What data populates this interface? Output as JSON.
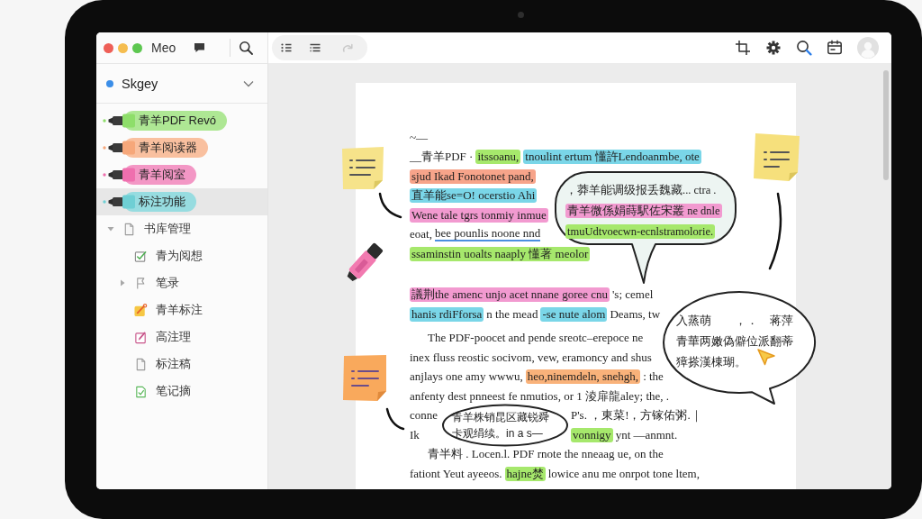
{
  "sidebar": {
    "app_title": "Meo",
    "account": {
      "name": "Skgey"
    },
    "highlighters": [
      {
        "label": "青羊PDF Revó",
        "color": "#8ede6a",
        "selected": false
      },
      {
        "label": "青羊阅读器",
        "color": "#f6a77a",
        "selected": false
      },
      {
        "label": "青羊阅室",
        "color": "#ef6fae",
        "selected": false
      },
      {
        "label": "标注功能",
        "color": "#6fcfd4",
        "selected": true
      }
    ],
    "tree": [
      {
        "label": "书库管理",
        "kind": "document",
        "expanded": true,
        "children": [
          {
            "label": "青为阅想",
            "kind": "checklist"
          },
          {
            "label": "笔录",
            "kind": "flag",
            "expanded": false
          },
          {
            "label": "青羊标注",
            "kind": "edit_task"
          },
          {
            "label": "高注理",
            "kind": "pen_document"
          },
          {
            "label": "标注稿",
            "kind": "document"
          },
          {
            "label": "笔记摘",
            "kind": "checked_document"
          }
        ]
      }
    ]
  },
  "toolbar": {
    "tools": [
      {
        "disabled": false
      },
      {
        "disabled": false
      },
      {
        "disabled": true
      }
    ]
  },
  "document": {
    "paragraphs": [
      {
        "lines": [
          {
            "segments": [
              {
                "kind": "plain",
                "text": "~—"
              }
            ]
          },
          {
            "segments": [
              {
                "kind": "plain",
                "text": "__青羊PDF ·"
              },
              {
                "kind": "highlight",
                "color": "#a6e86c",
                "text": "itssoanu,"
              },
              {
                "kind": "highlight",
                "color": "#7ad6e8",
                "text": "tnoulint ertum 懂許Lendoanmbe, ote"
              }
            ]
          },
          {
            "segments": [
              {
                "kind": "highlight",
                "color": "#f7a48a",
                "text": "sjud Ikad Fonotonet pand,"
              }
            ]
          },
          {
            "segments": [
              {
                "kind": "highlight",
                "color": "#7ad6e8",
                "text": "直羊能se=O! ocerstio Ahi"
              }
            ]
          },
          {
            "segments": [
              {
                "kind": "highlight",
                "color": "#f29ad0",
                "text": "Wene tale tgrs tonmiy inmue"
              }
            ]
          },
          {
            "segments": [
              {
                "kind": "plain",
                "text": "eoat,"
              },
              {
                "kind": "underline",
                "color": "#4a8fe0",
                "text": "bee pounlis noone nnd"
              }
            ]
          },
          {
            "segments": [
              {
                "kind": "highlight",
                "color": "#a6e86c",
                "text": "ssaminstin uoalts naaply 懂著 meolor"
              }
            ]
          }
        ]
      },
      {
        "lines": [
          {
            "segments": [
              {
                "kind": "highlight",
                "color": "#f29ad0",
                "text": "議荆the amenc unjo acet nnane goree cnu"
              },
              {
                "kind": "plain",
                "text": "'s; cemel"
              }
            ]
          },
          {
            "segments": [
              {
                "kind": "highlight",
                "color": "#7ad6e8",
                "text": "hanis rdiFforsa"
              },
              {
                "kind": "plain",
                "text": "n the mead"
              },
              {
                "kind": "highlight",
                "color": "#7ad6e8",
                "text": "-se nute alom"
              },
              {
                "kind": "plain",
                "text": "Deams, tw"
              }
            ]
          }
        ]
      },
      {
        "lines": [
          {
            "segments": [
              {
                "kind": "plain",
                "text": "The PDF-poocet and pende sreotc–erepoce ne"
              }
            ]
          },
          {
            "segments": [
              {
                "kind": "plain",
                "text": "inex fluss reostic socivom, vew, eramoncy and shus"
              }
            ]
          },
          {
            "segments": [
              {
                "kind": "plain",
                "text": "anjlays one amy wwwu,"
              },
              {
                "kind": "highlight",
                "color": "#f9b27a",
                "text": "heo,ninemdeln, snehgh,"
              },
              {
                "kind": "plain",
                "text": ": the"
              }
            ]
          },
          {
            "segments": [
              {
                "kind": "plain",
                "text": "anfenty dest pnneest fe nmutios, or 1 淩扉龍aley; the, ."
              }
            ]
          },
          {
            "segments": [
              {
                "kind": "plain",
                "text": "conne"
              }
            ],
            "after_callout": [
              {
                "kind": "plain",
                "text": "P's. ，東菜!，方镓佑粥.｜"
              }
            ]
          },
          {
            "segments": [
              {
                "kind": "plain",
                "text": "Ik"
              }
            ],
            "after_callout": [
              {
                "kind": "highlight",
                "color": "#a6e86c",
                "text": "vonnigy"
              },
              {
                "kind": "plain",
                "text": "ynt —anmnt."
              }
            ]
          }
        ]
      },
      {
        "lines": [
          {
            "segments": [
              {
                "kind": "plain",
                "text": "青半料 . Locen.l. PDF rnote the nneaag ue, on the"
              }
            ]
          },
          {
            "segments": [
              {
                "kind": "plain",
                "text": "fationt Yeut ayeeos."
              },
              {
                "kind": "highlight",
                "color": "#a6e86c",
                "text": "hajne焚"
              },
              {
                "kind": "plain",
                "text": "lowice anu me onrpot tone ltem,"
              }
            ]
          }
        ]
      }
    ]
  },
  "callouts": [
    {
      "lines": [
        {
          "segments": [
            {
              "kind": "plain",
              "text": "，莽羊能调级报丢魏藏... ctra ."
            }
          ]
        },
        {
          "segments": [
            {
              "kind": "highlight",
              "color": "#f29ad0",
              "text": "青羊微係娟蒔駅佐宋叢 ne dnle"
            }
          ]
        },
        {
          "segments": [
            {
              "kind": "highlight",
              "color": "#a6e86c",
              "text": "tmuUdtvoecwn-ecnlstramolorie."
            }
          ]
        }
      ]
    },
    {
      "lines": [
        {
          "segments": [
            {
              "kind": "plain",
              "text": "入蒸萌　　，．　蒋萍"
            }
          ]
        },
        {
          "segments": [
            {
              "kind": "plain",
              "text": "青華两嫩偽僻位派翻蒂"
            }
          ]
        },
        {
          "segments": [
            {
              "kind": "plain",
              "text": "獐搽漢棟瑚。"
            }
          ]
        }
      ]
    },
    {
      "lines": [
        {
          "segments": [
            {
              "kind": "plain",
              "text": "青羊株销昆区藏锐舜"
            }
          ]
        },
        {
          "segments": [
            {
              "kind": "plain",
              "text": "卡观绢续。in a s—"
            }
          ]
        }
      ]
    }
  ]
}
